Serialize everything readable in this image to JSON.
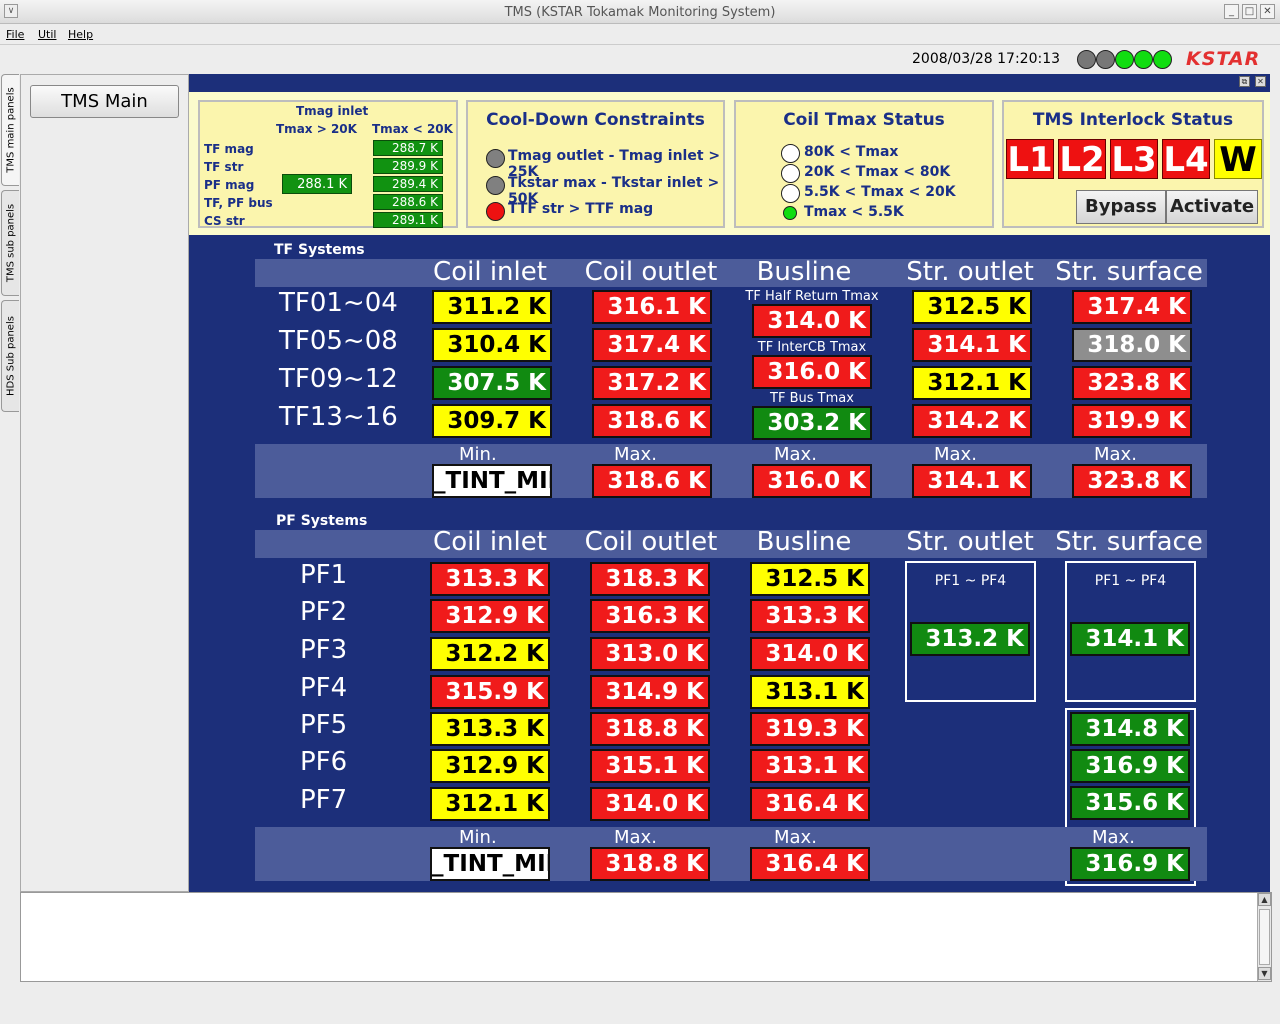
{
  "window": {
    "title": "TMS (KSTAR Tokamak Monitoring System)",
    "dropdown_glyph": "∨",
    "min_glyph": "_",
    "max_glyph": "□",
    "close_glyph": "✕"
  },
  "menu": {
    "file": "File",
    "util": "Util",
    "help": "Help"
  },
  "status": {
    "datetime": "2008/03/28 17:20:13",
    "logo": "KSTAR",
    "lamps": [
      "#777777",
      "#777777",
      "#11dd11",
      "#11dd11",
      "#11dd11"
    ]
  },
  "side_tabs": [
    "TMS main panels",
    "TMS sub panels",
    "HDS Sub panels"
  ],
  "nav": {
    "tms_main": "TMS Main"
  },
  "panel_ctl": {
    "float": "⧉",
    "close": "✕"
  },
  "tmag": {
    "title": "Tmag inlet",
    "col1": "Tmax > 20K",
    "col2": "Tmax < 20K",
    "rows": [
      "TF mag",
      "TF str",
      "PF mag",
      "TF, PF bus",
      "CS str"
    ],
    "left_value": "288.1 K",
    "right_values": [
      "288.7 K",
      "289.9 K",
      "289.4 K",
      "288.6 K",
      "289.1 K"
    ]
  },
  "cooldown": {
    "title": "Cool-Down Constraints",
    "items": [
      {
        "text": "Tmag outlet - Tmag inlet > 25K",
        "color": "#808080"
      },
      {
        "text": "Tkstar max - Tkstar inlet > 50K",
        "color": "#808080"
      },
      {
        "text": "TTF str > TTF mag",
        "color": "#ee1111"
      }
    ]
  },
  "coil_status": {
    "title": "Coil Tmax Status",
    "items": [
      {
        "text": "80K < Tmax",
        "color": "#ffffff"
      },
      {
        "text": "20K < Tmax < 80K",
        "color": "#ffffff"
      },
      {
        "text": "5.5K < Tmax < 20K",
        "color": "#ffffff"
      },
      {
        "text": "Tmax < 5.5K",
        "color": "#11dd11"
      }
    ]
  },
  "interlock": {
    "title": "TMS Interlock Status",
    "levels": [
      "L1",
      "L2",
      "L3",
      "L4",
      "W"
    ],
    "bypass": "Bypass",
    "activate": "Activate"
  },
  "tf": {
    "section": "TF Systems",
    "columns": [
      "Coil inlet",
      "Coil outlet",
      "Busline",
      "Str. outlet",
      "Str. surface"
    ],
    "rows": [
      "TF01~04",
      "TF05~08",
      "TF09~12",
      "TF13~16"
    ],
    "coil_inlet": [
      {
        "v": "311.2 K",
        "c": "yellow"
      },
      {
        "v": "310.4 K",
        "c": "yellow"
      },
      {
        "v": "307.5 K",
        "c": "green"
      },
      {
        "v": "309.7 K",
        "c": "yellow"
      }
    ],
    "coil_outlet": [
      {
        "v": "316.1 K",
        "c": "red"
      },
      {
        "v": "317.4 K",
        "c": "red"
      },
      {
        "v": "317.2 K",
        "c": "red"
      },
      {
        "v": "318.6 K",
        "c": "red"
      }
    ],
    "busline": [
      {
        "label": "TF Half Return Tmax",
        "v": "314.0 K",
        "c": "red"
      },
      {
        "label": "TF InterCB Tmax",
        "v": "316.0 K",
        "c": "red"
      },
      {
        "label": "TF Bus Tmax",
        "v": "303.2 K",
        "c": "green"
      }
    ],
    "str_outlet": [
      {
        "v": "312.5 K",
        "c": "yellow"
      },
      {
        "v": "314.1 K",
        "c": "red"
      },
      {
        "v": "312.1 K",
        "c": "yellow"
      },
      {
        "v": "314.2 K",
        "c": "red"
      }
    ],
    "str_surface": [
      {
        "v": "317.4 K",
        "c": "red"
      },
      {
        "v": "318.0 K",
        "c": "gray"
      },
      {
        "v": "323.8 K",
        "c": "red"
      },
      {
        "v": "319.9 K",
        "c": "red"
      }
    ],
    "footer": {
      "min_label": "Min.",
      "max_label": "Max.",
      "coil_inlet_min": "_TINT_MIN",
      "coil_outlet_max": "318.6 K",
      "busline_max": "316.0 K",
      "str_outlet_max": "314.1 K",
      "str_surface_max": "323.8 K"
    }
  },
  "pf": {
    "section": "PF Systems",
    "columns": [
      "Coil inlet",
      "Coil outlet",
      "Busline",
      "Str. outlet",
      "Str. surface"
    ],
    "rows": [
      "PF1",
      "PF2",
      "PF3",
      "PF4",
      "PF5",
      "PF6",
      "PF7"
    ],
    "coil_inlet": [
      {
        "v": "313.3 K",
        "c": "red"
      },
      {
        "v": "312.9 K",
        "c": "red"
      },
      {
        "v": "312.2 K",
        "c": "yellow"
      },
      {
        "v": "315.9 K",
        "c": "red"
      },
      {
        "v": "313.3 K",
        "c": "yellow"
      },
      {
        "v": "312.9 K",
        "c": "yellow"
      },
      {
        "v": "312.1 K",
        "c": "yellow"
      }
    ],
    "coil_outlet": [
      {
        "v": "318.3 K",
        "c": "red"
      },
      {
        "v": "316.3 K",
        "c": "red"
      },
      {
        "v": "313.0 K",
        "c": "red"
      },
      {
        "v": "314.9 K",
        "c": "red"
      },
      {
        "v": "318.8 K",
        "c": "red"
      },
      {
        "v": "315.1 K",
        "c": "red"
      },
      {
        "v": "314.0 K",
        "c": "red"
      }
    ],
    "busline": [
      {
        "v": "312.5 K",
        "c": "yellow"
      },
      {
        "v": "313.3 K",
        "c": "red"
      },
      {
        "v": "314.0 K",
        "c": "red"
      },
      {
        "v": "313.1 K",
        "c": "yellow"
      },
      {
        "v": "319.3 K",
        "c": "red"
      },
      {
        "v": "313.1 K",
        "c": "red"
      },
      {
        "v": "316.4 K",
        "c": "red"
      }
    ],
    "str_outlet_group": {
      "label": "PF1 ~ PF4",
      "v": "313.2 K",
      "c": "green"
    },
    "str_surface_group": {
      "label": "PF1 ~ PF4",
      "v": "314.1 K",
      "c": "green"
    },
    "str_surface_rows": [
      {
        "v": "314.8 K",
        "c": "green"
      },
      {
        "v": "316.9 K",
        "c": "green"
      },
      {
        "v": "315.6 K",
        "c": "green"
      }
    ],
    "footer": {
      "min_label": "Min.",
      "max_label": "Max.",
      "coil_inlet_min": "_TINT_MIN",
      "coil_outlet_max": "318.8 K",
      "busline_max": "316.4 K",
      "str_surface_max": "316.9 K"
    }
  },
  "scroll": {
    "up": "▲",
    "down": "▼"
  }
}
